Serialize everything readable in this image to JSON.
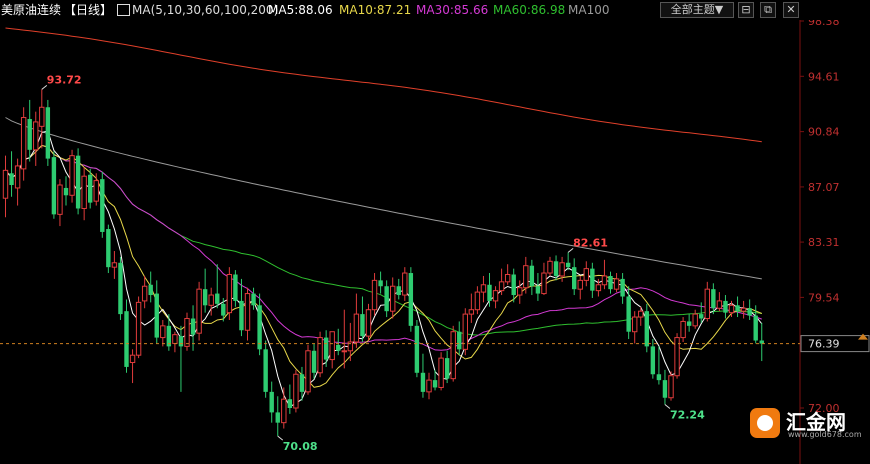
{
  "header": {
    "instrument": "美原油连续",
    "period": "【日线】",
    "ma_params": "MA(5,10,30,60,100,200)",
    "ma5": "MA5:88.06",
    "ma10": "MA10:87.21",
    "ma30": "MA30:85.66",
    "ma60": "MA60:86.98",
    "ma100": "MA100",
    "topic_button": "全部主题▼"
  },
  "colors": {
    "up": "#e03c3c",
    "down": "#2ecc71",
    "ma5": "#ffffff",
    "ma10": "#e8d84a",
    "ma30": "#d43ad4",
    "ma60": "#2fbf2f",
    "ma100": "#9a9a9a",
    "ma200": "#e0402a",
    "axis_text": "#c03030"
  },
  "logo": {
    "name": "汇金网",
    "url": "www.gold678.com"
  },
  "chart_data": {
    "type": "candlestick",
    "y_axis_ticks": [
      "98.38",
      "94.61",
      "90.84",
      "87.07",
      "83.31",
      "79.54",
      "72.00"
    ],
    "ylim": [
      72.0,
      98.38
    ],
    "last_price": "76.39",
    "annotations": [
      {
        "label": "93.72",
        "candle_index": 6,
        "type": "high"
      },
      {
        "label": "70.08",
        "candle_index": 45,
        "type": "low"
      },
      {
        "label": "82.61",
        "candle_index": 93,
        "type": "high"
      },
      {
        "label": "72.24",
        "candle_index": 109,
        "type": "low"
      }
    ],
    "candles": [
      {
        "o": 86.3,
        "h": 89.2,
        "l": 85.0,
        "c": 88.2
      },
      {
        "o": 88.0,
        "h": 89.5,
        "l": 86.4,
        "c": 87.2
      },
      {
        "o": 87.0,
        "h": 89.0,
        "l": 85.8,
        "c": 88.5
      },
      {
        "o": 88.3,
        "h": 92.5,
        "l": 87.5,
        "c": 91.8
      },
      {
        "o": 91.7,
        "h": 93.0,
        "l": 88.8,
        "c": 89.6
      },
      {
        "o": 89.6,
        "h": 92.2,
        "l": 88.5,
        "c": 91.5
      },
      {
        "o": 91.2,
        "h": 93.72,
        "l": 89.7,
        "c": 92.5
      },
      {
        "o": 92.5,
        "h": 93.0,
        "l": 88.5,
        "c": 89.0
      },
      {
        "o": 89.1,
        "h": 89.5,
        "l": 84.9,
        "c": 85.2
      },
      {
        "o": 85.2,
        "h": 87.6,
        "l": 84.4,
        "c": 87.2
      },
      {
        "o": 87.0,
        "h": 87.8,
        "l": 85.8,
        "c": 86.5
      },
      {
        "o": 86.5,
        "h": 89.6,
        "l": 86.0,
        "c": 89.2
      },
      {
        "o": 89.2,
        "h": 89.7,
        "l": 85.2,
        "c": 85.6
      },
      {
        "o": 85.6,
        "h": 88.4,
        "l": 84.8,
        "c": 87.8
      },
      {
        "o": 87.9,
        "h": 88.3,
        "l": 85.6,
        "c": 86.0
      },
      {
        "o": 86.1,
        "h": 88.0,
        "l": 85.8,
        "c": 87.5
      },
      {
        "o": 87.6,
        "h": 88.1,
        "l": 83.6,
        "c": 84.0
      },
      {
        "o": 84.2,
        "h": 84.5,
        "l": 81.2,
        "c": 81.6
      },
      {
        "o": 81.6,
        "h": 82.7,
        "l": 80.8,
        "c": 81.9
      },
      {
        "o": 81.9,
        "h": 82.3,
        "l": 78.0,
        "c": 78.4
      },
      {
        "o": 78.6,
        "h": 79.4,
        "l": 74.4,
        "c": 74.8
      },
      {
        "o": 75.1,
        "h": 76.0,
        "l": 73.7,
        "c": 75.6
      },
      {
        "o": 75.6,
        "h": 79.6,
        "l": 75.4,
        "c": 79.2
      },
      {
        "o": 79.3,
        "h": 81.0,
        "l": 78.8,
        "c": 80.3
      },
      {
        "o": 80.4,
        "h": 81.3,
        "l": 79.2,
        "c": 79.7
      },
      {
        "o": 79.8,
        "h": 80.7,
        "l": 76.4,
        "c": 76.8
      },
      {
        "o": 76.8,
        "h": 78.0,
        "l": 76.2,
        "c": 77.6
      },
      {
        "o": 77.6,
        "h": 78.4,
        "l": 75.9,
        "c": 76.2
      },
      {
        "o": 76.4,
        "h": 77.2,
        "l": 75.8,
        "c": 77.0
      },
      {
        "o": 76.9,
        "h": 77.6,
        "l": 73.1,
        "c": 76.2
      },
      {
        "o": 76.2,
        "h": 78.5,
        "l": 75.9,
        "c": 78.1
      },
      {
        "o": 78.1,
        "h": 79.0,
        "l": 75.9,
        "c": 77.0
      },
      {
        "o": 77.1,
        "h": 80.6,
        "l": 76.6,
        "c": 80.1
      },
      {
        "o": 80.1,
        "h": 81.5,
        "l": 78.5,
        "c": 79.0
      },
      {
        "o": 79.0,
        "h": 80.2,
        "l": 78.3,
        "c": 79.7
      },
      {
        "o": 79.8,
        "h": 81.8,
        "l": 78.8,
        "c": 79.1
      },
      {
        "o": 79.1,
        "h": 79.5,
        "l": 77.9,
        "c": 78.3
      },
      {
        "o": 78.5,
        "h": 81.6,
        "l": 78.0,
        "c": 81.1
      },
      {
        "o": 81.1,
        "h": 81.4,
        "l": 78.9,
        "c": 79.3
      },
      {
        "o": 79.3,
        "h": 80.8,
        "l": 76.9,
        "c": 77.3
      },
      {
        "o": 77.3,
        "h": 80.2,
        "l": 76.6,
        "c": 79.8
      },
      {
        "o": 79.8,
        "h": 80.2,
        "l": 78.7,
        "c": 79.0
      },
      {
        "o": 79.0,
        "h": 79.8,
        "l": 75.6,
        "c": 76.0
      },
      {
        "o": 76.0,
        "h": 76.6,
        "l": 72.7,
        "c": 73.1
      },
      {
        "o": 73.1,
        "h": 73.8,
        "l": 71.0,
        "c": 71.7
      },
      {
        "o": 71.7,
        "h": 72.8,
        "l": 70.08,
        "c": 71.0
      },
      {
        "o": 71.0,
        "h": 73.4,
        "l": 70.6,
        "c": 72.6
      },
      {
        "o": 72.6,
        "h": 73.6,
        "l": 71.6,
        "c": 72.0
      },
      {
        "o": 72.0,
        "h": 74.6,
        "l": 71.7,
        "c": 74.3
      },
      {
        "o": 74.3,
        "h": 74.8,
        "l": 72.5,
        "c": 73.1
      },
      {
        "o": 73.1,
        "h": 76.3,
        "l": 72.9,
        "c": 75.9
      },
      {
        "o": 75.9,
        "h": 76.4,
        "l": 74.0,
        "c": 74.4
      },
      {
        "o": 74.4,
        "h": 77.2,
        "l": 74.1,
        "c": 76.8
      },
      {
        "o": 76.8,
        "h": 77.3,
        "l": 74.8,
        "c": 75.3
      },
      {
        "o": 75.3,
        "h": 77.2,
        "l": 74.7,
        "c": 77.2
      },
      {
        "o": 76.3,
        "h": 77.4,
        "l": 75.6,
        "c": 75.9
      },
      {
        "o": 75.9,
        "h": 78.7,
        "l": 74.7,
        "c": 75.9
      },
      {
        "o": 75.9,
        "h": 77.8,
        "l": 75.2,
        "c": 76.5
      },
      {
        "o": 76.5,
        "h": 79.8,
        "l": 76.1,
        "c": 78.4
      },
      {
        "o": 78.4,
        "h": 79.6,
        "l": 76.5,
        "c": 76.9
      },
      {
        "o": 76.9,
        "h": 79.1,
        "l": 76.6,
        "c": 78.7
      },
      {
        "o": 78.7,
        "h": 81.2,
        "l": 78.3,
        "c": 80.7
      },
      {
        "o": 80.7,
        "h": 81.3,
        "l": 79.8,
        "c": 80.3
      },
      {
        "o": 80.3,
        "h": 80.7,
        "l": 78.2,
        "c": 78.6
      },
      {
        "o": 78.6,
        "h": 80.9,
        "l": 78.1,
        "c": 80.3
      },
      {
        "o": 80.3,
        "h": 80.8,
        "l": 79.4,
        "c": 79.7
      },
      {
        "o": 79.7,
        "h": 81.6,
        "l": 79.3,
        "c": 81.2
      },
      {
        "o": 81.2,
        "h": 81.6,
        "l": 77.2,
        "c": 77.6
      },
      {
        "o": 77.6,
        "h": 78.0,
        "l": 74.1,
        "c": 74.4
      },
      {
        "o": 74.4,
        "h": 75.7,
        "l": 72.7,
        "c": 73.1
      },
      {
        "o": 73.1,
        "h": 74.4,
        "l": 72.6,
        "c": 73.9
      },
      {
        "o": 73.9,
        "h": 74.6,
        "l": 73.2,
        "c": 73.4
      },
      {
        "o": 73.4,
        "h": 75.8,
        "l": 73.2,
        "c": 75.4
      },
      {
        "o": 75.4,
        "h": 75.9,
        "l": 73.7,
        "c": 74.0
      },
      {
        "o": 74.0,
        "h": 77.6,
        "l": 73.8,
        "c": 77.2
      },
      {
        "o": 77.2,
        "h": 77.9,
        "l": 75.6,
        "c": 76.0
      },
      {
        "o": 76.0,
        "h": 78.8,
        "l": 75.6,
        "c": 78.4
      },
      {
        "o": 78.4,
        "h": 79.8,
        "l": 77.8,
        "c": 78.7
      },
      {
        "o": 78.7,
        "h": 80.3,
        "l": 78.4,
        "c": 79.9
      },
      {
        "o": 79.9,
        "h": 81.0,
        "l": 79.2,
        "c": 80.4
      },
      {
        "o": 80.4,
        "h": 81.2,
        "l": 78.9,
        "c": 79.3
      },
      {
        "o": 79.3,
        "h": 80.3,
        "l": 78.8,
        "c": 80.0
      },
      {
        "o": 80.0,
        "h": 81.5,
        "l": 79.7,
        "c": 80.6
      },
      {
        "o": 80.6,
        "h": 81.8,
        "l": 80.4,
        "c": 81.1
      },
      {
        "o": 81.1,
        "h": 81.5,
        "l": 79.2,
        "c": 79.7
      },
      {
        "o": 79.7,
        "h": 80.7,
        "l": 79.1,
        "c": 80.2
      },
      {
        "o": 80.2,
        "h": 82.3,
        "l": 79.8,
        "c": 81.7
      },
      {
        "o": 81.7,
        "h": 82.1,
        "l": 79.7,
        "c": 80.3
      },
      {
        "o": 80.3,
        "h": 81.2,
        "l": 79.3,
        "c": 79.8
      },
      {
        "o": 79.8,
        "h": 81.9,
        "l": 79.7,
        "c": 81.2
      },
      {
        "o": 81.2,
        "h": 82.3,
        "l": 81.0,
        "c": 82.0
      },
      {
        "o": 82.0,
        "h": 82.4,
        "l": 80.7,
        "c": 81.0
      },
      {
        "o": 81.0,
        "h": 82.3,
        "l": 80.6,
        "c": 81.9
      },
      {
        "o": 81.9,
        "h": 82.61,
        "l": 81.4,
        "c": 81.6
      },
      {
        "o": 81.6,
        "h": 82.2,
        "l": 79.7,
        "c": 80.1
      },
      {
        "o": 80.1,
        "h": 81.0,
        "l": 79.4,
        "c": 80.7
      },
      {
        "o": 80.7,
        "h": 82.0,
        "l": 80.3,
        "c": 81.5
      },
      {
        "o": 81.5,
        "h": 81.9,
        "l": 79.5,
        "c": 80.0
      },
      {
        "o": 80.0,
        "h": 80.8,
        "l": 79.6,
        "c": 80.4
      },
      {
        "o": 80.4,
        "h": 82.1,
        "l": 80.1,
        "c": 81.0
      },
      {
        "o": 81.0,
        "h": 81.3,
        "l": 79.8,
        "c": 80.1
      },
      {
        "o": 80.1,
        "h": 81.2,
        "l": 79.9,
        "c": 80.8
      },
      {
        "o": 80.8,
        "h": 81.2,
        "l": 79.1,
        "c": 79.6
      },
      {
        "o": 79.6,
        "h": 80.3,
        "l": 76.7,
        "c": 77.2
      },
      {
        "o": 77.2,
        "h": 78.6,
        "l": 76.4,
        "c": 78.2
      },
      {
        "o": 78.2,
        "h": 78.9,
        "l": 77.6,
        "c": 78.6
      },
      {
        "o": 78.6,
        "h": 79.1,
        "l": 75.8,
        "c": 76.2
      },
      {
        "o": 76.2,
        "h": 76.7,
        "l": 74.0,
        "c": 74.3
      },
      {
        "o": 74.3,
        "h": 76.2,
        "l": 73.6,
        "c": 73.9
      },
      {
        "o": 73.9,
        "h": 74.6,
        "l": 72.24,
        "c": 72.7
      },
      {
        "o": 72.7,
        "h": 74.5,
        "l": 72.5,
        "c": 74.2
      },
      {
        "o": 74.2,
        "h": 77.1,
        "l": 74.0,
        "c": 76.8
      },
      {
        "o": 76.8,
        "h": 78.2,
        "l": 76.5,
        "c": 77.9
      },
      {
        "o": 77.9,
        "h": 78.4,
        "l": 77.2,
        "c": 77.6
      },
      {
        "o": 77.6,
        "h": 78.7,
        "l": 77.4,
        "c": 78.4
      },
      {
        "o": 78.4,
        "h": 79.2,
        "l": 77.8,
        "c": 78.1
      },
      {
        "o": 78.1,
        "h": 80.6,
        "l": 77.9,
        "c": 80.1
      },
      {
        "o": 80.1,
        "h": 80.5,
        "l": 78.4,
        "c": 78.8
      },
      {
        "o": 78.8,
        "h": 79.9,
        "l": 78.6,
        "c": 79.3
      },
      {
        "o": 79.3,
        "h": 79.7,
        "l": 78.1,
        "c": 78.5
      },
      {
        "o": 78.5,
        "h": 79.3,
        "l": 78.2,
        "c": 79.0
      },
      {
        "o": 79.0,
        "h": 79.6,
        "l": 78.2,
        "c": 78.6
      },
      {
        "o": 78.6,
        "h": 79.3,
        "l": 78.1,
        "c": 78.8
      },
      {
        "o": 78.8,
        "h": 79.4,
        "l": 78.0,
        "c": 78.3
      },
      {
        "o": 78.3,
        "h": 79.0,
        "l": 76.4,
        "c": 76.6
      },
      {
        "o": 76.6,
        "h": 77.8,
        "l": 75.2,
        "c": 76.39
      }
    ],
    "ma100_end": 80.8,
    "ma200_start": 97.9,
    "ma200_end": 90.0
  }
}
